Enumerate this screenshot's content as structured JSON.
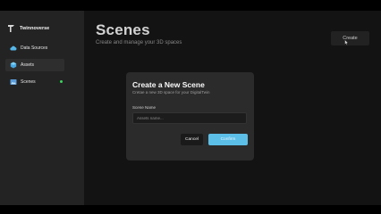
{
  "app": {
    "name": "Twinnoverse"
  },
  "sidebar": {
    "items": [
      {
        "label": "Data Sources",
        "icon": "cloud-icon"
      },
      {
        "label": "Assets",
        "icon": "cube-icon"
      },
      {
        "label": "Scenes",
        "icon": "scene-icon",
        "active": true
      }
    ]
  },
  "header": {
    "title": "Scenes",
    "subtitle": "Create and manage your 3D spaces",
    "create_label": "Create"
  },
  "dialog": {
    "title": "Create a New Scene",
    "description": "Cretae a new 3D space for your DigitalTwin",
    "field_label": "Scene Name",
    "input_placeholder": "Assets name...",
    "input_value": "",
    "cancel_label": "Cancel",
    "confirm_label": "Confirm"
  },
  "colors": {
    "accent": "#5cbfe8",
    "active_indicator": "#3cd35e",
    "cloud_icon": "#57b6e8",
    "scenes_icon": "#5a9bd8"
  }
}
